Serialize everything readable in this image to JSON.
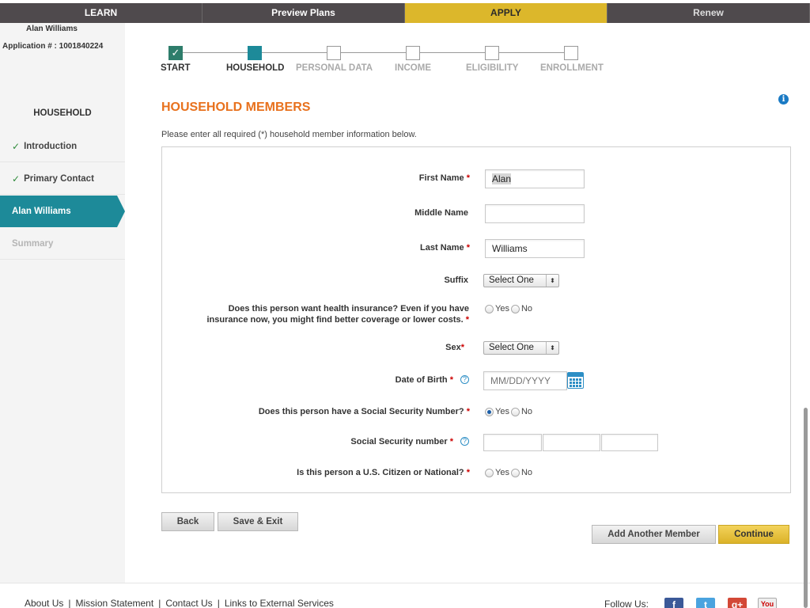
{
  "topnav": {
    "tabs": [
      {
        "label": "LEARN"
      },
      {
        "label": "Preview Plans"
      },
      {
        "label": "APPLY"
      },
      {
        "label": "Renew"
      }
    ]
  },
  "sidebar": {
    "user_name": "Alan Williams",
    "application": "Application # : 1001840224",
    "heading": "HOUSEHOLD",
    "items": [
      {
        "label": "Introduction",
        "state": "complete"
      },
      {
        "label": "Primary Contact",
        "state": "complete"
      },
      {
        "label": "Alan Williams",
        "state": "active"
      },
      {
        "label": "Summary",
        "state": "disabled"
      }
    ]
  },
  "progress": {
    "steps": [
      {
        "label": "START",
        "state": "done",
        "mark": "✓"
      },
      {
        "label": "HOUSEHOLD",
        "state": "current"
      },
      {
        "label": "PERSONAL DATA",
        "state": "todo"
      },
      {
        "label": "INCOME",
        "state": "todo"
      },
      {
        "label": "ELIGIBILITY",
        "state": "todo"
      },
      {
        "label": "ENROLLMENT",
        "state": "todo"
      }
    ]
  },
  "main": {
    "title": "HOUSEHOLD MEMBERS",
    "info_icon": "i",
    "intro": "Please enter all required (*) household member information below."
  },
  "form": {
    "required_mark": "*",
    "first_name": {
      "label": "First Name",
      "value": "Alan"
    },
    "middle_name": {
      "label": "Middle Name",
      "value": ""
    },
    "last_name": {
      "label": "Last Name",
      "value": "Williams"
    },
    "suffix": {
      "label": "Suffix",
      "value": "Select One"
    },
    "health_insurance": {
      "label_line1": "Does this person want health insurance? Even if you have",
      "label_line2": "insurance now, you might find better coverage or lower costs.",
      "yes": "Yes",
      "no": "No",
      "selected": "none"
    },
    "sex": {
      "label": "Sex",
      "value": "Select One"
    },
    "dob": {
      "label": "Date of Birth",
      "placeholder": "MM/DD/YYYY",
      "help": "?"
    },
    "has_ssn": {
      "label": "Does this person have a Social Security Number?",
      "yes": "Yes",
      "no": "No",
      "selected": "yes"
    },
    "ssn": {
      "label": "Social Security number",
      "help": "?"
    },
    "citizen": {
      "label": "Is this person a U.S. Citizen or National?",
      "yes": "Yes",
      "no": "No",
      "selected": "none"
    },
    "select_arrows": "⬍"
  },
  "buttons": {
    "back": "Back",
    "save_exit": "Save & Exit",
    "add_member": "Add Another Member",
    "continue": "Continue"
  },
  "footer": {
    "links": [
      "About Us",
      "Mission Statement",
      "Contact Us",
      "Links to External Services"
    ],
    "separator": "|",
    "follow": "Follow Us:",
    "social": [
      {
        "name": "facebook",
        "glyph": "f"
      },
      {
        "name": "twitter",
        "glyph": "t"
      },
      {
        "name": "google-plus",
        "glyph": "g+"
      },
      {
        "name": "youtube",
        "glyph": "You"
      }
    ]
  },
  "colors": {
    "nav_dark": "#4f4a4d",
    "apply_gold": "#dcb72b",
    "teal": "#1d8a99",
    "title_orange": "#e8711d",
    "required_red": "#cc0000",
    "continue_gold": "#e8c33c"
  }
}
